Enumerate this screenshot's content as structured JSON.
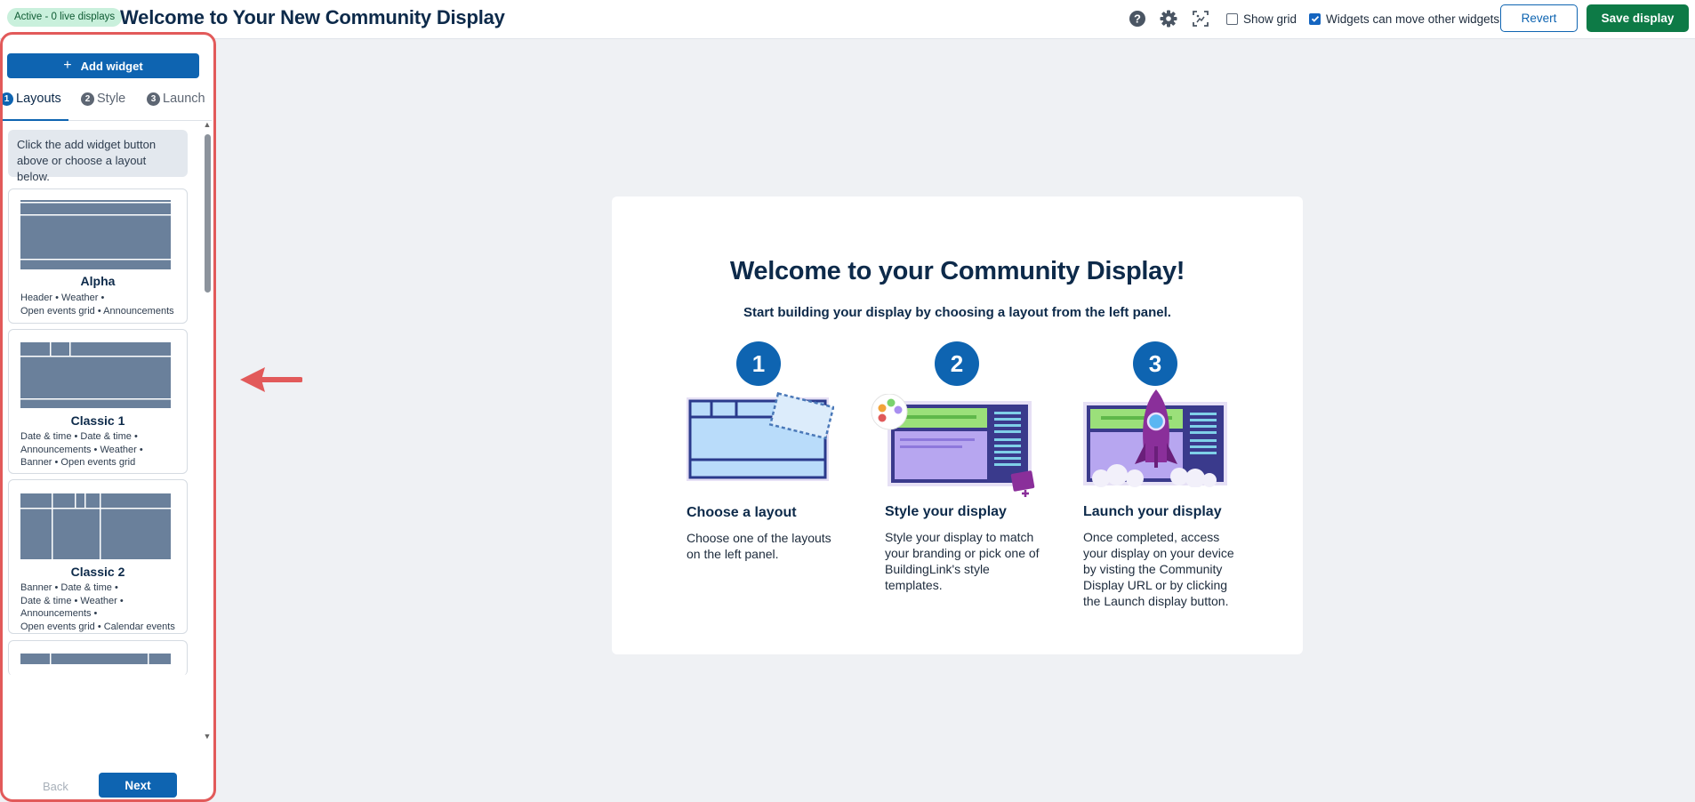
{
  "header": {
    "status_badge": "Active - 0 live displays",
    "title": "Welcome to Your New Community Display",
    "show_grid_label": "Show grid",
    "show_grid_checked": false,
    "widgets_move_label": "Widgets can move other widgets",
    "widgets_move_checked": true,
    "revert_label": "Revert",
    "save_label": "Save display",
    "icons": [
      "help-icon",
      "gear-icon",
      "screen-capture-icon"
    ]
  },
  "sidebar": {
    "add_widget_label": "Add widget",
    "tabs": [
      {
        "num": "1",
        "label": "Layouts",
        "active": true
      },
      {
        "num": "2",
        "label": "Style",
        "active": false
      },
      {
        "num": "3",
        "label": "Launch",
        "active": false
      }
    ],
    "hint": "Click the add widget button above or choose a layout below.",
    "layouts": [
      {
        "name": "Alpha",
        "desc_lines": [
          "Header • Weather •",
          "Open events grid • Announcements"
        ]
      },
      {
        "name": "Classic 1",
        "desc_lines": [
          "Date & time • Date & time •",
          "Announcements • Weather •",
          "Banner • Open events grid"
        ]
      },
      {
        "name": "Classic 2",
        "desc_lines": [
          "Banner • Date & time •",
          "Date & time • Weather •",
          "Announcements •",
          "Open events grid • Calendar events"
        ]
      }
    ],
    "back_label": "Back",
    "next_label": "Next"
  },
  "welcome": {
    "title": "Welcome to your Community Display!",
    "subtitle": "Start building your display by choosing a layout from the left panel.",
    "steps": [
      {
        "num": "1",
        "title": "Choose a layout",
        "desc": "Choose one of the layouts on the left panel."
      },
      {
        "num": "2",
        "title": "Style your display",
        "desc": "Style your display to match your branding or pick one of BuildingLink's style templates."
      },
      {
        "num": "3",
        "title": "Launch your display",
        "desc": "Once completed, access your display on your device by visting the Community Display URL or by clicking the Launch display button."
      }
    ]
  },
  "colors": {
    "primary": "#0e64b1",
    "save": "#0d7a46",
    "highlight": "#e25a5a",
    "layout_thumb": "#6a809b"
  }
}
